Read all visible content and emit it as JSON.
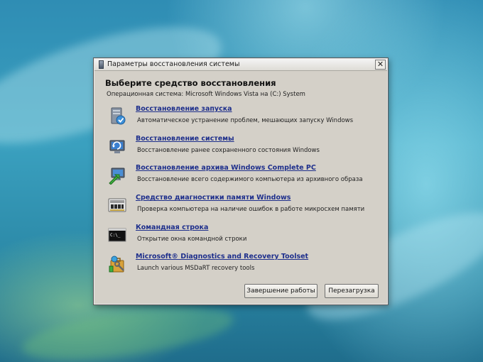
{
  "window": {
    "title": "Параметры восстановления системы",
    "close_glyph": "✕"
  },
  "heading": "Выберите средство восстановления",
  "os_info": "Операционная система: Microsoft Windows Vista на (C:) System",
  "tools": [
    {
      "label": "Восстановление запуска",
      "description": "Автоматическое устранение проблем, мешающих запуску Windows",
      "icon": "startup-repair-icon"
    },
    {
      "label": "Восстановление системы",
      "description": "Восстановление ранее сохраненного состояния Windows",
      "icon": "system-restore-icon"
    },
    {
      "label": "Восстановление архива Windows Complete PC",
      "description": "Восстановление всего содержимого компьютера из архивного образа",
      "icon": "complete-pc-restore-icon"
    },
    {
      "label": "Средство диагностики памяти Windows",
      "description": "Проверка компьютера на наличие ошибок в работе микросхем памяти",
      "icon": "memory-diagnostic-icon"
    },
    {
      "label": "Командная строка",
      "description": "Открытие окна командной строки",
      "icon": "command-prompt-icon"
    },
    {
      "label": "Microsoft® Diagnostics and Recovery Toolset",
      "description": "Launch various MSDaRT recovery tools",
      "icon": "dart-toolset-icon"
    }
  ],
  "buttons": {
    "shutdown": "Завершение работы",
    "restart": "Перезагрузка"
  }
}
